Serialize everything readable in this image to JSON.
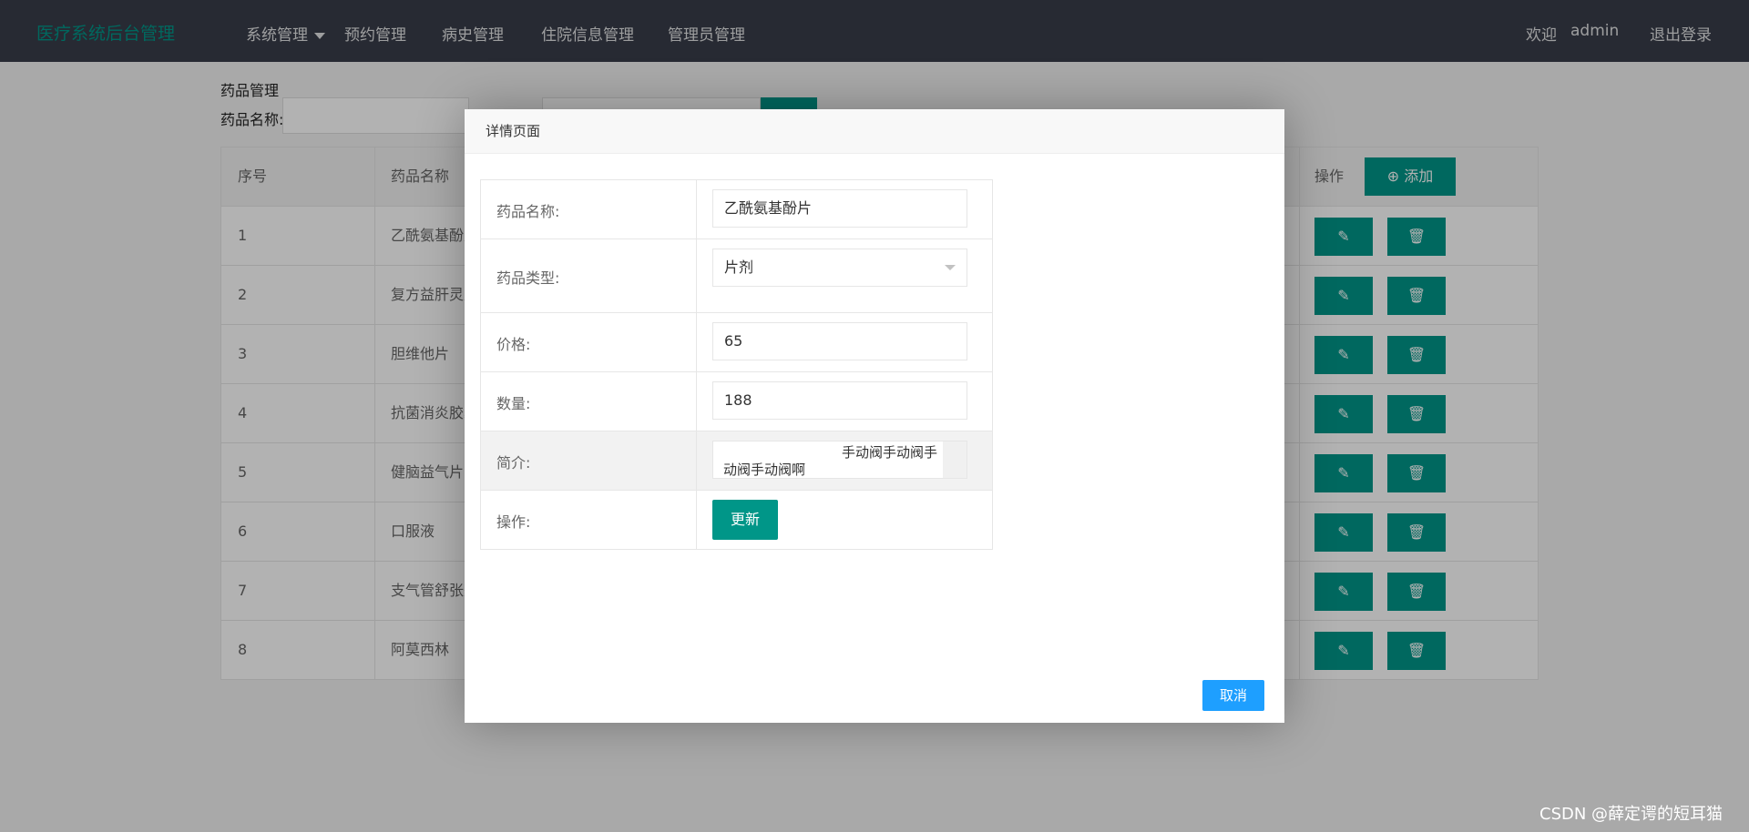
{
  "brand": "医疗系统后台管理",
  "nav": {
    "items": [
      "系统管理",
      "预约管理",
      "病史管理",
      "住院信息管理",
      "管理员管理"
    ]
  },
  "user": {
    "welcome": "欢迎",
    "name": "admin",
    "logout": "退出登录"
  },
  "page": {
    "title": "药品管理",
    "search_label": "药品名称:",
    "table": {
      "headers": {
        "idx": "序号",
        "name": "药品名称",
        "ops": "操作"
      },
      "add_label": "添加",
      "rows": [
        {
          "idx": "1",
          "name": "乙酰氨基酚片"
        },
        {
          "idx": "2",
          "name": "复方益肝灵片"
        },
        {
          "idx": "3",
          "name": "胆维他片"
        },
        {
          "idx": "4",
          "name": "抗菌消炎胶囊"
        },
        {
          "idx": "5",
          "name": "健脑益气片"
        },
        {
          "idx": "6",
          "name": "口服液"
        },
        {
          "idx": "7",
          "name": "支气管舒张剂"
        },
        {
          "idx": "8",
          "name": "阿莫西林"
        }
      ]
    }
  },
  "modal": {
    "title": "详情页面",
    "fields": {
      "name_label": "药品名称:",
      "name_value": "乙酰氨基酚片",
      "type_label": "药品类型:",
      "type_value": "片剂",
      "price_label": "价格:",
      "price_value": "65",
      "qty_label": "数量:",
      "qty_value": "188",
      "intro_label": "简介:",
      "intro_line1": "手动阀手动阀手",
      "intro_line2": "动阀手动阀啊",
      "ops_label": "操作:"
    },
    "update_label": "更新",
    "cancel_label": "取消"
  },
  "watermark": "CSDN @薛定谔的短耳猫",
  "colors": {
    "primary": "#009688",
    "nav_bg": "#393d49",
    "cancel": "#1e9fff"
  }
}
